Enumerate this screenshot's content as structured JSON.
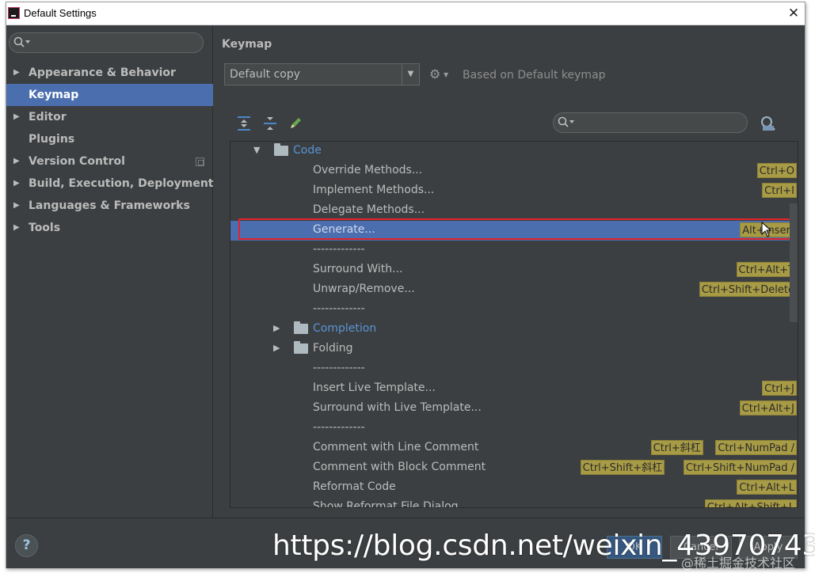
{
  "window": {
    "title": "Default Settings",
    "close_glyph": "✕"
  },
  "sidebar": {
    "search": {
      "placeholder": ""
    },
    "items": [
      {
        "label": "Appearance & Behavior",
        "expandable": true
      },
      {
        "label": "Keymap",
        "selected": true
      },
      {
        "label": "Editor",
        "expandable": true
      },
      {
        "label": "Plugins"
      },
      {
        "label": "Version Control",
        "expandable": true
      },
      {
        "label": "Build, Execution, Deployment",
        "expandable": true
      },
      {
        "label": "Languages & Frameworks",
        "expandable": true
      },
      {
        "label": "Tools",
        "expandable": true
      }
    ]
  },
  "keymap": {
    "title": "Keymap",
    "scheme": "Default copy",
    "based_on": "Based on Default keymap",
    "search": {
      "placeholder": ""
    }
  },
  "tree": {
    "rows": [
      {
        "label": "Code",
        "type": "folder",
        "expanded": true,
        "link": true
      },
      {
        "label": "Override Methods...",
        "shortcuts": [
          "Ctrl+O"
        ]
      },
      {
        "label": "Implement Methods...",
        "shortcuts": [
          "Ctrl+I"
        ]
      },
      {
        "label": "Delegate Methods...",
        "shortcuts": []
      },
      {
        "label": "Generate...",
        "shortcuts": [
          "Alt+Insert"
        ],
        "selected": true
      },
      {
        "label": "-------------",
        "shortcuts": []
      },
      {
        "label": "Surround With...",
        "shortcuts": [
          "Ctrl+Alt+T"
        ]
      },
      {
        "label": "Unwrap/Remove...",
        "shortcuts": [
          "Ctrl+Shift+Delete"
        ]
      },
      {
        "label": "-------------",
        "shortcuts": []
      },
      {
        "label": "Completion",
        "type": "folder",
        "expanded": false,
        "link": true
      },
      {
        "label": "Folding",
        "type": "folder",
        "expanded": false
      },
      {
        "label": "-------------",
        "shortcuts": []
      },
      {
        "label": "Insert Live Template...",
        "shortcuts": [
          "Ctrl+J"
        ]
      },
      {
        "label": "Surround with Live Template...",
        "shortcuts": [
          "Ctrl+Alt+J"
        ]
      },
      {
        "label": "-------------",
        "shortcuts": []
      },
      {
        "label": "Comment with Line Comment",
        "shortcuts": [
          "Ctrl+斜杠",
          "Ctrl+NumPad /"
        ]
      },
      {
        "label": "Comment with Block Comment",
        "shortcuts": [
          "Ctrl+Shift+斜杠",
          "Ctrl+Shift+NumPad /"
        ]
      },
      {
        "label": "Reformat Code",
        "shortcuts": [
          "Ctrl+Alt+L"
        ]
      },
      {
        "label": "Show Reformat File Dialog",
        "shortcuts": [
          "Ctrl+Alt+Shift+L"
        ]
      }
    ]
  },
  "buttons": {
    "help": "?",
    "ok": "OK",
    "cancel": "Cancel",
    "apply": "Apply"
  },
  "watermark": {
    "url": "https://blog.csdn.net/weixin_43970743",
    "credit": "@稀土掘金技术社区"
  },
  "colors": {
    "accent_selection": "#4b6eaf",
    "shortcut_bg": "#a89b45",
    "highlight_frame": "#e2232a",
    "link": "#5894d6"
  }
}
